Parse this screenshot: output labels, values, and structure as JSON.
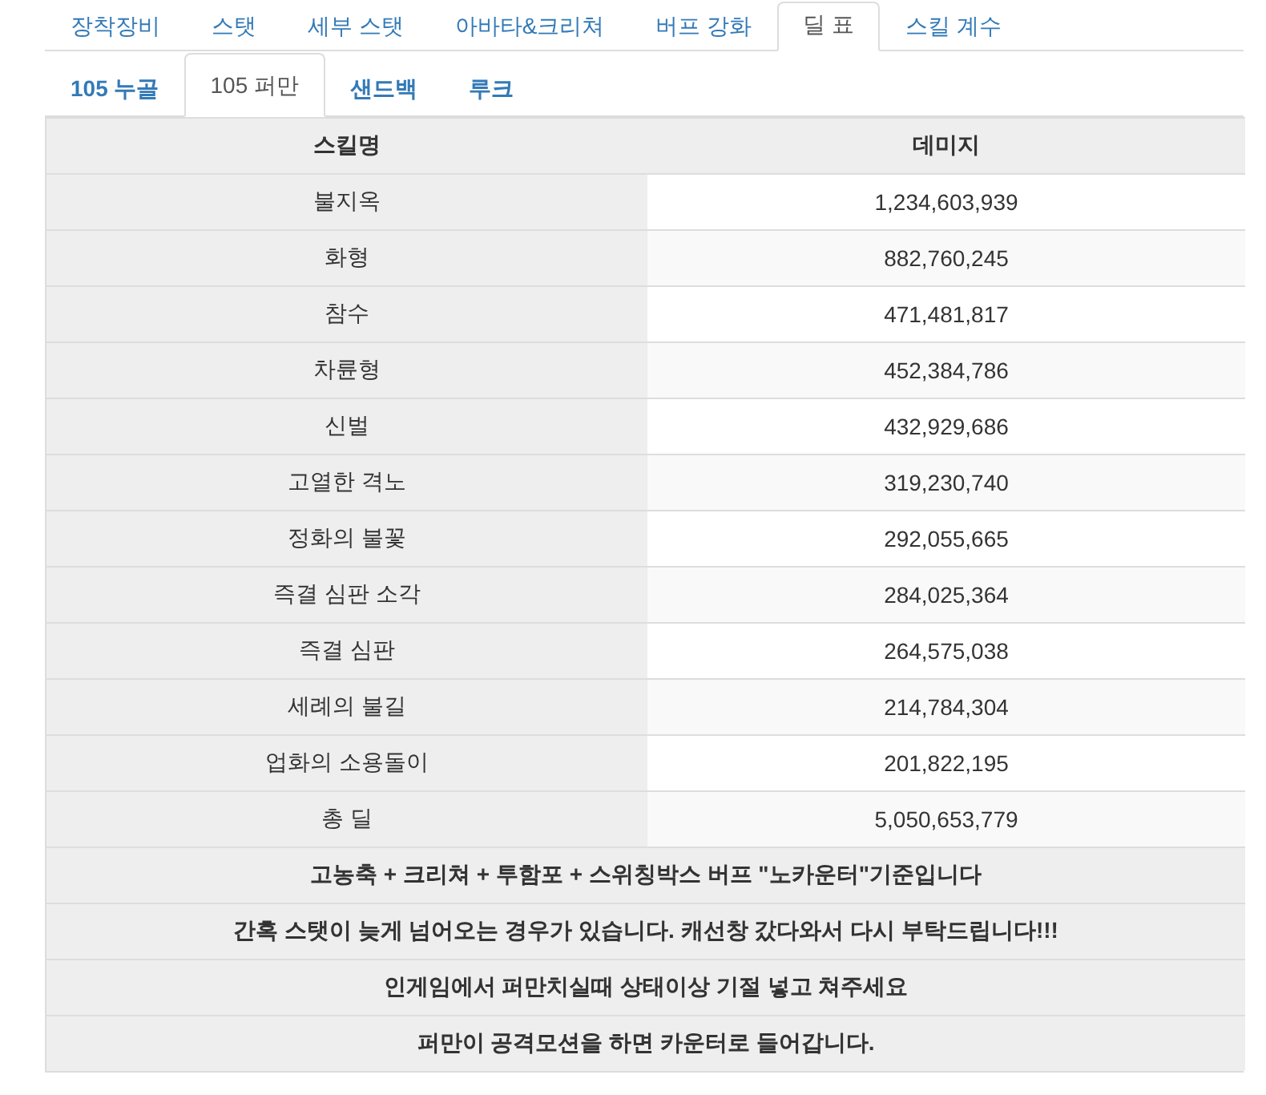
{
  "main_tabs": [
    {
      "label": "장착장비",
      "selected": false
    },
    {
      "label": "스탯",
      "selected": false
    },
    {
      "label": "세부 스탯",
      "selected": false
    },
    {
      "label": "아바타&크리쳐",
      "selected": false
    },
    {
      "label": "버프 강화",
      "selected": false
    },
    {
      "label": "딜 표",
      "selected": true
    },
    {
      "label": "스킬 계수",
      "selected": false
    }
  ],
  "sub_tabs": [
    {
      "label": "105 누골",
      "selected": false
    },
    {
      "label": "105 퍼만",
      "selected": true
    },
    {
      "label": "샌드백",
      "selected": false
    },
    {
      "label": "루크",
      "selected": false
    }
  ],
  "table": {
    "columns": [
      "스킬명",
      "데미지"
    ],
    "rows": [
      {
        "skill": "불지옥",
        "damage": "1,234,603,939"
      },
      {
        "skill": "화형",
        "damage": "882,760,245"
      },
      {
        "skill": "참수",
        "damage": "471,481,817"
      },
      {
        "skill": "차륜형",
        "damage": "452,384,786"
      },
      {
        "skill": "신벌",
        "damage": "432,929,686"
      },
      {
        "skill": "고열한 격노",
        "damage": "319,230,740"
      },
      {
        "skill": "정화의 불꽃",
        "damage": "292,055,665"
      },
      {
        "skill": "즉결 심판 소각",
        "damage": "284,025,364"
      },
      {
        "skill": "즉결 심판",
        "damage": "264,575,038"
      },
      {
        "skill": "세례의 불길",
        "damage": "214,784,304"
      },
      {
        "skill": "업화의 소용돌이",
        "damage": "201,822,195"
      },
      {
        "skill": "총 딜",
        "damage": "5,050,653,779"
      }
    ],
    "notes": [
      "고농축 + 크리쳐 + 투함포 + 스위칭박스 버프 \"노카운터\"기준입니다",
      "간혹 스탯이 늦게 넘어오는 경우가 있습니다. 캐선창 갔다와서 다시 부탁드립니다!!!",
      "인게임에서 퍼만치실때 상태이상 기절 넣고 쳐주세요",
      "퍼만이 공격모션을 하면 카운터로 들어갑니다."
    ]
  }
}
